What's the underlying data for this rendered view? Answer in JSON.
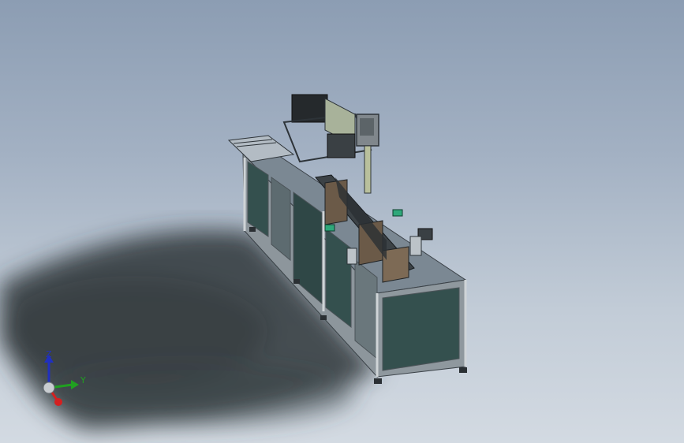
{
  "viewport": {
    "background_top": "#8c9db3",
    "background_bottom": "#d3dae2"
  },
  "model": {
    "frame_color": "#9aa1a6",
    "panel_color": "#34504e",
    "door_color": "#2f4746",
    "top_color": "#7c8a95"
  },
  "triad": {
    "z_label": "Z",
    "y_label": "Y",
    "x_color": "#d42020",
    "y_color": "#20a020",
    "z_color": "#2030c0"
  }
}
